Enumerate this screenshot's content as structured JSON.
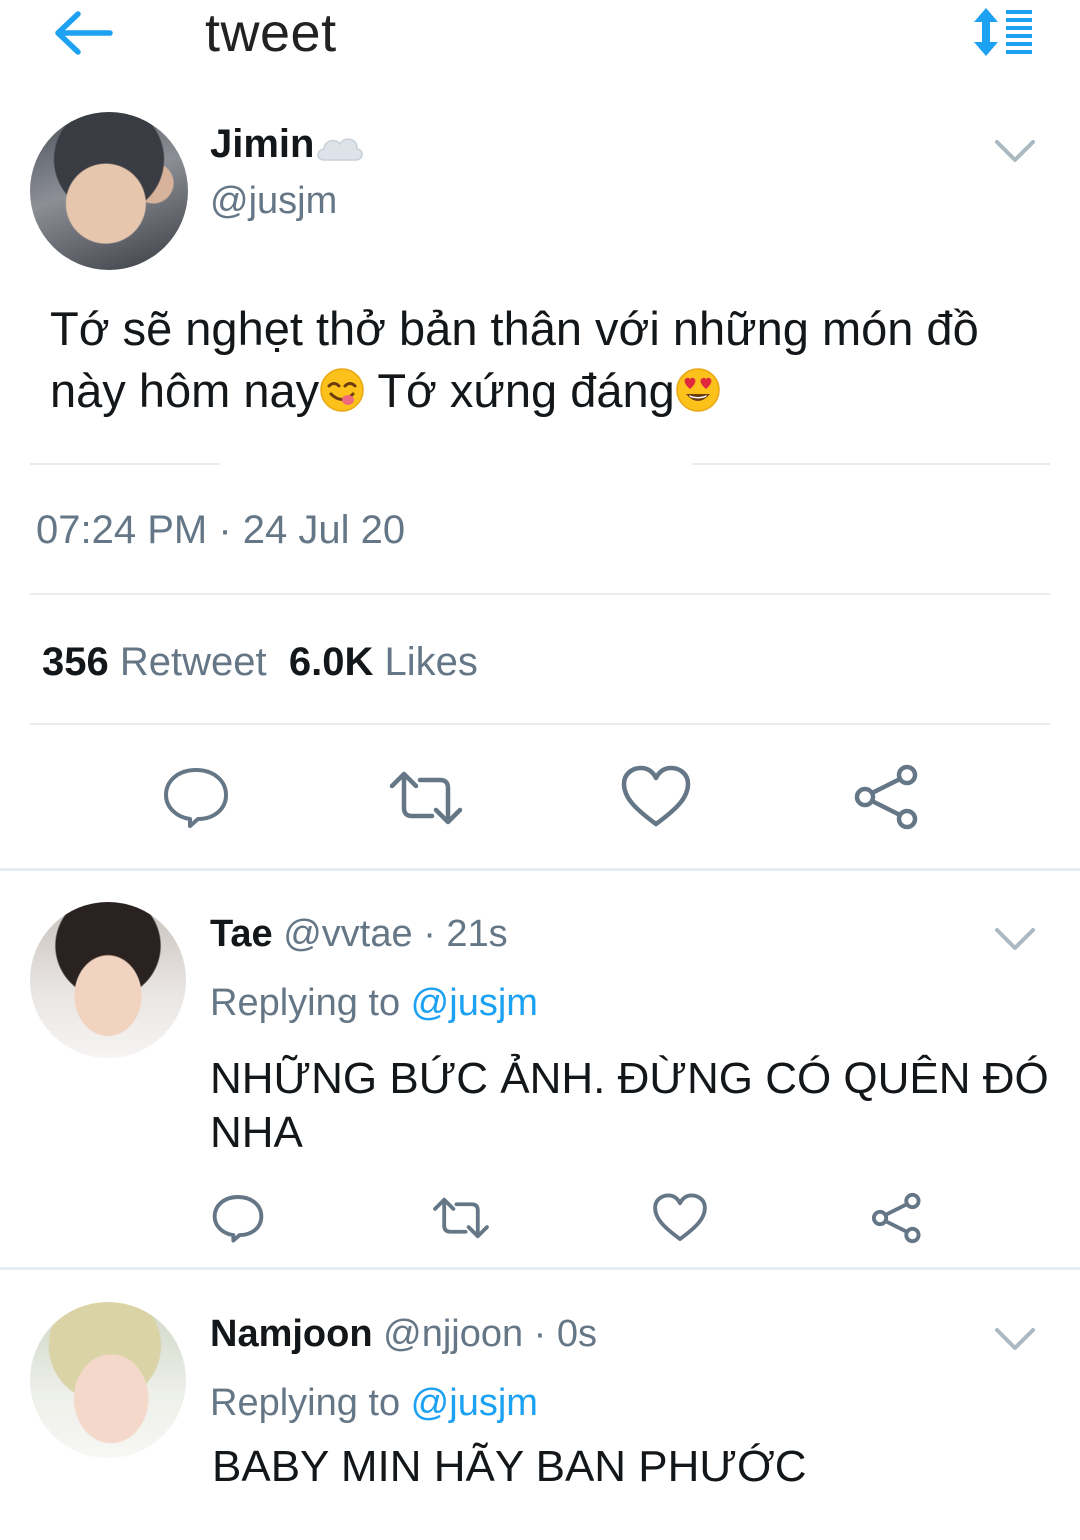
{
  "header": {
    "title": "tweet",
    "back_icon": "arrow-left-icon",
    "sort_icon": "sort-list-icon",
    "accent_color": "#1da1f2"
  },
  "tweet": {
    "author_name": "Jimin",
    "author_badge_icon": "cloud-icon",
    "author_handle": "@jusjm",
    "text_part1": "Tớ sẽ nghẹt thở bản thân với những món đồ này hôm nay",
    "emoji1": "yum-face-emoji",
    "text_part2": " Tớ xứng đáng",
    "emoji2": "heart-eyes-emoji",
    "timestamp": "07:24 PM · 24 Jul 20",
    "retweet_count": "356",
    "retweet_label": " Retweet",
    "likes_count": "6.0K",
    "likes_label": " Likes",
    "actions": [
      "reply-icon",
      "retweet-icon",
      "like-icon",
      "share-icon"
    ]
  },
  "replies": [
    {
      "name": "Tae",
      "handle": " @vvtae",
      "time": " · 21s",
      "replying_prefix": "Replying to ",
      "replying_to": "@jusjm",
      "text": "NHỮNG BỨC ẢNH. ĐỪNG CÓ QUÊN ĐÓ NHA"
    },
    {
      "name": "Namjoon",
      "handle": " @njjoon",
      "time": " · 0s",
      "replying_prefix": "Replying to ",
      "replying_to": "@jusjm",
      "text": "BABY MIN HÃY BAN PHƯỚC"
    }
  ]
}
